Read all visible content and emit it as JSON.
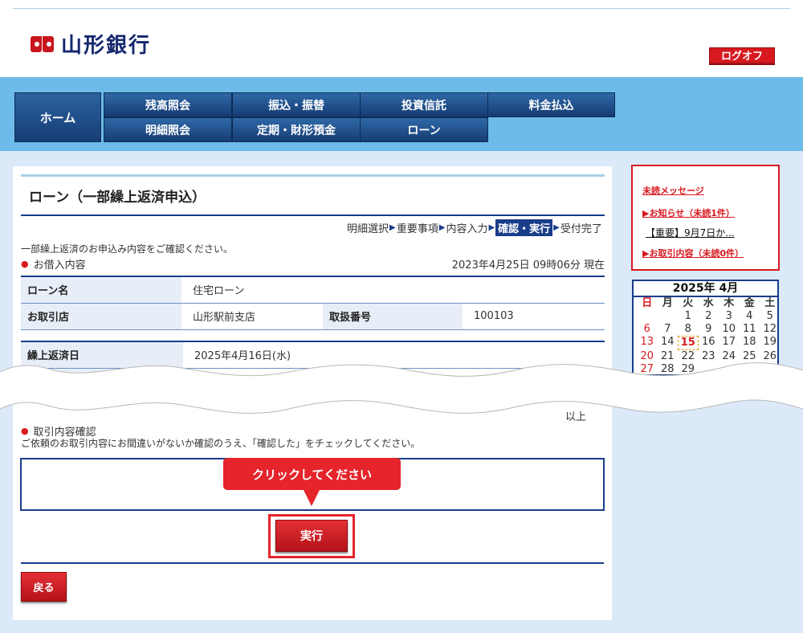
{
  "header": {
    "bank_name": "山形銀行",
    "logoff_label": "ログオフ"
  },
  "nav": {
    "home": "ホーム",
    "items": [
      {
        "label": "残高照会"
      },
      {
        "label": "振込・振替"
      },
      {
        "label": "投資信託"
      },
      {
        "label": "料金払込"
      },
      {
        "label": "明細照会"
      },
      {
        "label": "定期・財形預金"
      },
      {
        "label": "ローン"
      }
    ]
  },
  "page": {
    "title": "ローン（一部繰上返済申込）",
    "steps": [
      {
        "label": "明細選択",
        "active": false
      },
      {
        "label": "重要事項",
        "active": false
      },
      {
        "label": "内容入力",
        "active": false
      },
      {
        "label": "確認・実行",
        "active": true
      },
      {
        "label": "受付完了",
        "active": false
      }
    ],
    "note": "一部繰上返済のお申込み内容をご確認ください。",
    "section_loan": "お借入内容",
    "datetime": "2023年4月25日 09時06分 現在",
    "loan_table": {
      "loan_name_label": "ローン名",
      "loan_name_value": "住宅ローン",
      "branch_label": "お取引店",
      "branch_value": "山形駅前支店",
      "handling_no_label": "取扱番号",
      "handling_no_value": "100103"
    },
    "prepay_table": {
      "date_label": "繰上返済日",
      "date_value": "2025年4月16日(水)"
    },
    "end_mark": "以上",
    "section_confirm": "取引内容確認",
    "confirm_text": "ご依頼のお取引内容にお間違いがないか確認のうえ、「確認した」をチェックしてください。",
    "tooltip": "クリックしてください",
    "execute_label": "実行",
    "back_label": "戻る"
  },
  "messages": {
    "title": "未読メッセージ",
    "notice_link": "▶お知らせ（未読1件）",
    "notice_item": "【重要】9月7日か...",
    "trade_link": "▶お取引内容（未読0件）"
  },
  "calendar": {
    "title": "2025年 4月",
    "weekdays": [
      "日",
      "月",
      "火",
      "水",
      "木",
      "金",
      "土"
    ],
    "weeks": [
      [
        "",
        "",
        "1",
        "2",
        "3",
        "4",
        "5"
      ],
      [
        "6",
        "7",
        "8",
        "9",
        "10",
        "11",
        "12"
      ],
      [
        "13",
        "14",
        "15",
        "16",
        "17",
        "18",
        "19"
      ],
      [
        "20",
        "21",
        "22",
        "23",
        "24",
        "25",
        "26"
      ],
      [
        "27",
        "28",
        "29",
        "",
        "",
        "",
        ""
      ]
    ],
    "today": "15"
  },
  "colors": {
    "brand_red": "#d8191f",
    "navy": "#1a3d8a",
    "nav_band": "#6cbbe9",
    "page_bg": "#dbe9f8"
  }
}
